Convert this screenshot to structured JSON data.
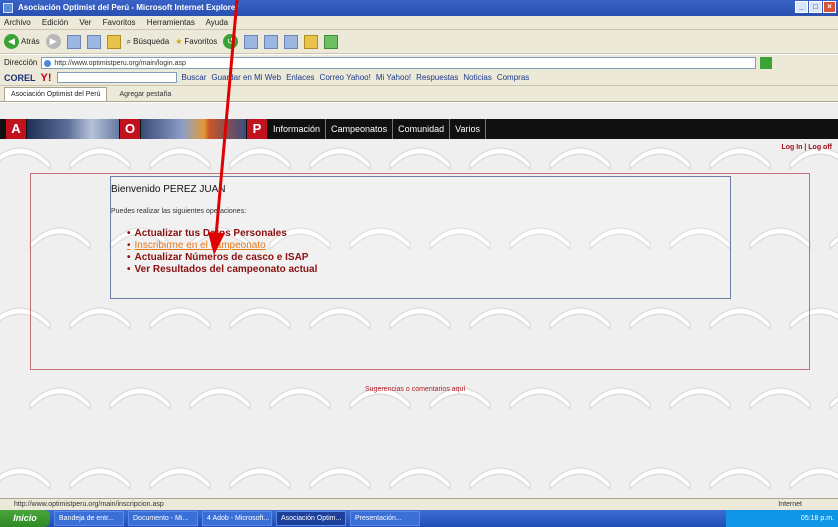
{
  "window": {
    "title": "Asociación Optimist del Perú - Microsoft Internet Explorer"
  },
  "menu": [
    "Archivo",
    "Edición",
    "Ver",
    "Favoritos",
    "Herramientas",
    "Ayuda"
  ],
  "toolbar": {
    "back_label": "Atrás",
    "search_label": "Búsqueda",
    "favorites_label": "Favoritos"
  },
  "address": {
    "label": "Dirección",
    "url": "http://www.optimistperu.org/main/login.asp"
  },
  "corel": {
    "brand": "COREL",
    "yahoo": "Y!",
    "search_label": "Buscar",
    "links": [
      "Guardar en Mi Web",
      "Enlaces",
      "Correo Yahoo!",
      "Mi Yahoo!",
      "Respuestas",
      "Noticias",
      "Compras"
    ]
  },
  "tabs": {
    "active": "Asociación Optimist del Perú",
    "add": "Agregar pestaña"
  },
  "site": {
    "nav_squares": [
      "A",
      "O",
      "P"
    ],
    "nav_links": [
      "Información",
      "Campeonatos",
      "Comunidad",
      "Varios"
    ],
    "login_links": "Log In | Log off",
    "welcome": "Bienvenido PEREZ JUAN",
    "instructions": "Puedes realizar las siguientes operaciones:",
    "options": [
      "Actualizar tus Datos Personales",
      "Inscribirme en el campeonato",
      "Actualizar Números de casco e ISAP",
      "Ver Resultados del campeonato actual"
    ],
    "footer_link": "Sugerencias o comentarios aquí"
  },
  "status": {
    "url": "http://www.optimistperu.org/main/inscripcion.asp",
    "zone": "Internet"
  },
  "taskbar": {
    "start": "Inicio",
    "items": [
      "Bandeja de entr...",
      "Documento - Mi...",
      "4 Adob - Microsoft...",
      "Asociación Optim...",
      "Presentación..."
    ],
    "clock": "05:18 p.m."
  },
  "colors": {
    "accent_red": "#c1121f",
    "link_orange": "#e47b1a",
    "option_red": "#8a1010"
  }
}
